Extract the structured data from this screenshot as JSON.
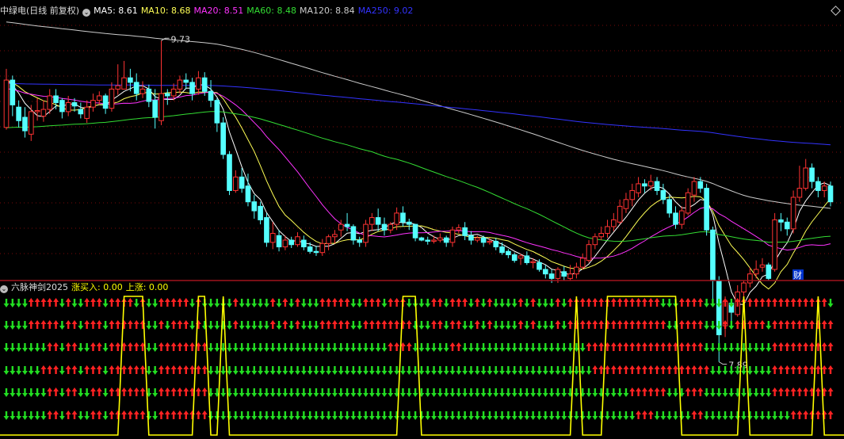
{
  "main_panel": {
    "stock_title": "中绿电(日线 前复权)",
    "indicators": [
      {
        "label": "MA5: 8.61",
        "color": "#ffffff"
      },
      {
        "label": "MA10: 8.68",
        "color": "#ffff55"
      },
      {
        "label": "MA20: 8.51",
        "color": "#ff33ff"
      },
      {
        "label": "MA60: 8.48",
        "color": "#33dd33"
      },
      {
        "label": "MA120: 8.84",
        "color": "#cccccc"
      },
      {
        "label": "MA250: 9.02",
        "color": "#3333ff"
      }
    ],
    "annotations": {
      "high": "9.73",
      "low": "7.89",
      "badge": "财"
    }
  },
  "sub_panel": {
    "title": "六脉神剑2025",
    "values": [
      {
        "label": "涨买入: 0.00",
        "color": "#ffff00"
      },
      {
        "label": "上涨: 0.00",
        "color": "#ffff00"
      }
    ]
  },
  "colors": {
    "up": "#ff3333",
    "down": "#55ffff",
    "arrow_up": "#ff2222",
    "arrow_down": "#22dd22",
    "signal": "#ffff00"
  },
  "chart_data": {
    "type": "candlestick",
    "ylim": [
      7.7,
      9.95
    ],
    "candles": [
      [
        8.96,
        9.38,
        9.48,
        8.94
      ],
      [
        9.38,
        9.16,
        9.42,
        9.06
      ],
      [
        9.14,
        9.02,
        9.2,
        8.96
      ],
      [
        9.05,
        8.93,
        9.14,
        8.87
      ],
      [
        8.9,
        9.1,
        9.16,
        8.84
      ],
      [
        9.1,
        9.11,
        9.22,
        9.02
      ],
      [
        9.06,
        9.12,
        9.2,
        9.01
      ],
      [
        9.12,
        9.24,
        9.3,
        9.08
      ],
      [
        9.24,
        9.18,
        9.3,
        9.12
      ],
      [
        9.2,
        9.1,
        9.22,
        9.04
      ],
      [
        9.1,
        9.18,
        9.24,
        9.06
      ],
      [
        9.18,
        9.15,
        9.22,
        9.1
      ],
      [
        9.12,
        9.08,
        9.18,
        9.04
      ],
      [
        9.04,
        9.14,
        9.2,
        9
      ],
      [
        9.14,
        9.2,
        9.26,
        9.1
      ],
      [
        9.2,
        9.24,
        9.28,
        9.16
      ],
      [
        9.24,
        9.13,
        9.26,
        9.08
      ],
      [
        9.13,
        9.3,
        9.36,
        9.1
      ],
      [
        9.3,
        9.33,
        9.52,
        9.25
      ],
      [
        9.3,
        9.4,
        9.55,
        9.3
      ],
      [
        9.4,
        9.36,
        9.48,
        9.28
      ],
      [
        9.36,
        9.26,
        9.44,
        9.2
      ],
      [
        9.26,
        9.3,
        9.37,
        9.22
      ],
      [
        9.3,
        9.19,
        9.34,
        9.14
      ],
      [
        9.2,
        9.05,
        9.3,
        8.95
      ],
      [
        9.02,
        9.26,
        9.73,
        8.98
      ],
      [
        9.26,
        9.24,
        9.3,
        9.16
      ],
      [
        9.24,
        9.3,
        9.35,
        9.2
      ],
      [
        9.3,
        9.38,
        9.42,
        9.26
      ],
      [
        9.38,
        9.36,
        9.44,
        9.3
      ],
      [
        9.36,
        9.26,
        9.4,
        9.2
      ],
      [
        9.3,
        9.4,
        9.46,
        9.25
      ],
      [
        9.4,
        9.28,
        9.45,
        9.24
      ],
      [
        9.28,
        9.2,
        9.38,
        9.14
      ],
      [
        9.2,
        9.0,
        9.22,
        8.92
      ],
      [
        9.0,
        8.72,
        9.05,
        8.68
      ],
      [
        8.72,
        8.4,
        8.75,
        8.36
      ],
      [
        8.4,
        8.52,
        8.58,
        8.38
      ],
      [
        8.52,
        8.42,
        8.6,
        8.38
      ],
      [
        8.44,
        8.3,
        8.55,
        8.26
      ],
      [
        8.3,
        8.22,
        8.36,
        8.15
      ],
      [
        8.26,
        8.14,
        8.3,
        8.1
      ],
      [
        8.16,
        7.94,
        8.2,
        7.9
      ],
      [
        7.94,
        8.02,
        8.12,
        7.88
      ],
      [
        8.0,
        7.9,
        8.05,
        7.86
      ],
      [
        7.9,
        7.96,
        8.0,
        7.87
      ],
      [
        7.96,
        7.92,
        7.99,
        7.89
      ],
      [
        7.92,
        7.99,
        8.03,
        7.9
      ],
      [
        7.96,
        7.9,
        8.0,
        7.87
      ],
      [
        7.9,
        7.86,
        7.94,
        7.84
      ],
      [
        7.86,
        7.85,
        7.91,
        7.82
      ],
      [
        7.85,
        7.93,
        7.97,
        7.82
      ],
      [
        7.93,
        7.99,
        8.01,
        7.87
      ],
      [
        7.99,
        8.01,
        8.05,
        7.93
      ],
      [
        8.05,
        8.1,
        8.14,
        7.99
      ],
      [
        8.1,
        8.08,
        8.2,
        8.04
      ],
      [
        8.08,
        7.96,
        8.1,
        7.92
      ],
      [
        7.96,
        7.94,
        7.99,
        7.9
      ],
      [
        7.94,
        8.1,
        8.14,
        7.9
      ],
      [
        8.1,
        8.16,
        8.2,
        8.04
      ],
      [
        8.16,
        8.1,
        8.24,
        8.04
      ],
      [
        8.1,
        8.05,
        8.16,
        8
      ],
      [
        8.05,
        8.1,
        8.12,
        8.02
      ],
      [
        8.1,
        8.2,
        8.25,
        8.05
      ],
      [
        8.2,
        8.12,
        8.26,
        8.08
      ],
      [
        8.12,
        8.1,
        8.15,
        8.05
      ],
      [
        8.1,
        7.98,
        8.1,
        7.95
      ],
      [
        7.98,
        7.96,
        7.99,
        7.95
      ],
      [
        7.96,
        7.95,
        7.99,
        7.92
      ],
      [
        7.95,
        7.96,
        8.0,
        7.93
      ],
      [
        7.96,
        7.98,
        8.02,
        7.94
      ],
      [
        7.98,
        7.94,
        8.0,
        7.9
      ],
      [
        7.94,
        8.05,
        8.08,
        7.9
      ],
      [
        8.05,
        8.07,
        8.1,
        8.02
      ],
      [
        8.07,
        8.0,
        8.12,
        7.96
      ],
      [
        8.0,
        7.96,
        8.04,
        7.92
      ],
      [
        7.96,
        7.98,
        8.0,
        7.94
      ],
      [
        7.98,
        7.94,
        8.0,
        7.9
      ],
      [
        7.94,
        7.95,
        7.98,
        7.92
      ],
      [
        7.95,
        7.9,
        7.98,
        7.87
      ],
      [
        7.9,
        7.85,
        7.94,
        7.83
      ],
      [
        7.86,
        7.83,
        7.88,
        7.8
      ],
      [
        7.83,
        7.78,
        7.85,
        7.76
      ],
      [
        7.8,
        7.82,
        7.84,
        7.74
      ],
      [
        7.82,
        7.76,
        7.86,
        7.74
      ],
      [
        7.76,
        7.77,
        7.8,
        7.71
      ],
      [
        7.76,
        7.7,
        7.79,
        7.68
      ],
      [
        7.7,
        7.66,
        7.74,
        7.62
      ],
      [
        7.66,
        7.62,
        7.7,
        7.58
      ],
      [
        7.62,
        7.7,
        7.72,
        7.58
      ],
      [
        7.68,
        7.64,
        7.73,
        7.6
      ],
      [
        7.62,
        7.66,
        7.74,
        7.6
      ],
      [
        7.66,
        7.72,
        7.76,
        7.62
      ],
      [
        7.72,
        7.8,
        7.84,
        7.7
      ],
      [
        7.78,
        7.92,
        7.96,
        7.76
      ],
      [
        7.92,
        7.99,
        8.02,
        7.88
      ],
      [
        7.99,
        8.02,
        8.08,
        7.96
      ],
      [
        8.02,
        8.08,
        8.14,
        7.98
      ],
      [
        8.08,
        8.14,
        8.2,
        8.04
      ],
      [
        8.12,
        8.26,
        8.32,
        8.1
      ],
      [
        8.24,
        8.32,
        8.38,
        8.2
      ],
      [
        8.32,
        8.4,
        8.46,
        8.26
      ],
      [
        8.38,
        8.46,
        8.52,
        8.34
      ],
      [
        8.46,
        8.44,
        8.5,
        8.38
      ],
      [
        8.44,
        8.48,
        8.54,
        8.4
      ],
      [
        8.48,
        8.4,
        8.52,
        8.36
      ],
      [
        8.4,
        8.32,
        8.46,
        8.28
      ],
      [
        8.32,
        8.2,
        8.36,
        8.16
      ],
      [
        8.2,
        8.1,
        8.26,
        8.06
      ],
      [
        8.1,
        8.22,
        8.26,
        8.06
      ],
      [
        8.2,
        8.38,
        8.42,
        8.18
      ],
      [
        8.36,
        8.48,
        8.52,
        8.3
      ],
      [
        8.48,
        8.42,
        8.52,
        8.38
      ],
      [
        8.42,
        8.05,
        8.46,
        8.0
      ],
      [
        8.05,
        7.6,
        8.08,
        7.4
      ],
      [
        7.6,
        7.12,
        7.64,
        6.88
      ],
      [
        7.2,
        7.42,
        7.46,
        7.1
      ],
      [
        7.4,
        7.32,
        7.44,
        7.22
      ],
      [
        7.3,
        7.5,
        7.56,
        7.28
      ],
      [
        7.5,
        7.58,
        7.6,
        7.46
      ],
      [
        7.58,
        7.66,
        7.72,
        7.54
      ],
      [
        7.66,
        7.7,
        7.78,
        7.62
      ],
      [
        7.72,
        7.74,
        7.8,
        7.68
      ],
      [
        7.74,
        7.62,
        7.76,
        7.6
      ],
      [
        7.7,
        8.14,
        8.2,
        7.68
      ],
      [
        8.14,
        8.12,
        8.2,
        8.04
      ],
      [
        8.12,
        8.06,
        8.16,
        8.0
      ],
      [
        8.06,
        8.34,
        8.4,
        8.02
      ],
      [
        8.34,
        8.42,
        8.62,
        8.3
      ],
      [
        8.42,
        8.6,
        8.68,
        8.4
      ],
      [
        8.6,
        8.48,
        8.64,
        8.42
      ],
      [
        8.48,
        8.4,
        8.52,
        8.34
      ],
      [
        8.4,
        8.44,
        8.48,
        8.34
      ],
      [
        8.44,
        8.3,
        8.48,
        8.26
      ]
    ]
  }
}
